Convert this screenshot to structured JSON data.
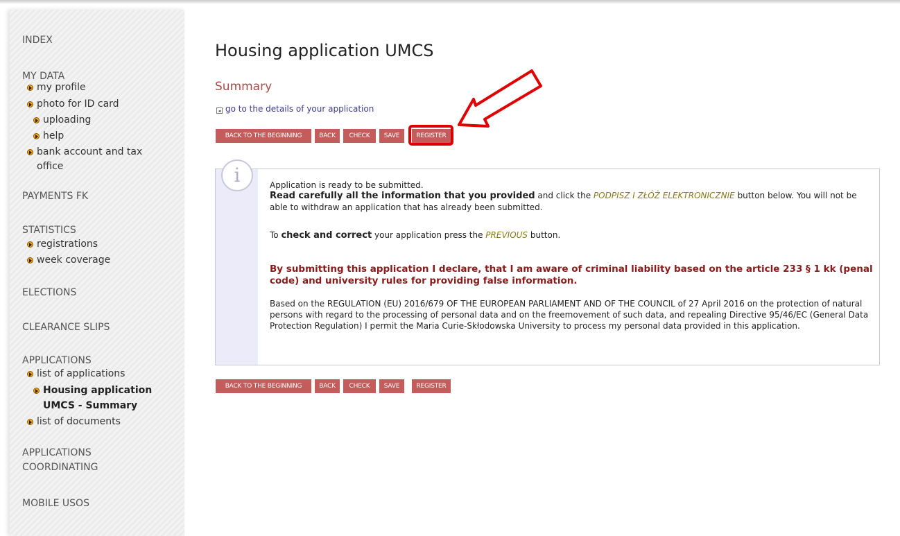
{
  "sidebar": {
    "index": "INDEX",
    "my_data": "MY DATA",
    "my_profile": "my profile",
    "photo": "photo for ID card",
    "uploading": "uploading",
    "help": "help",
    "bank_line1": "bank account and tax",
    "bank_line2": "office",
    "payments": "PAYMENTS FK",
    "statistics": "STATISTICS",
    "registrations": "registrations",
    "week_coverage": "week coverage",
    "elections": "ELECTIONS",
    "clearance": "CLEARANCE SLIPS",
    "applications": "APPLICATIONS",
    "list_applications": "list of applications",
    "current_line1": "Housing application",
    "current_line2": "UMCS - Summary",
    "list_documents": "list of documents",
    "coord_line1": "APPLICATIONS",
    "coord_line2": "COORDINATING",
    "mobile": "MOBILE USOS"
  },
  "main": {
    "title": "Housing application UMCS",
    "subtitle": "Summary",
    "details_link": "go to the details of your application"
  },
  "buttons": {
    "back_to_beginning": "BACK TO THE BEGINNING",
    "back": "BACK",
    "check": "CHECK",
    "save": "SAVE",
    "register": "REGISTER"
  },
  "info": {
    "line1": "Application is ready to be submitted.",
    "read_bold": "Read carefully all the information that you provided",
    "read_after1": " and click the ",
    "sign_button": "PODPISZ I ZŁÓŻ ELEKTRONICZNIE",
    "read_after2": " button below. You will not be able to withdraw an application that has already been submitted.",
    "to": "To ",
    "check_bold": "check and correct",
    "check_after1": " your application press the ",
    "previous": "PREVIOUS",
    "check_after2": " button.",
    "declaration": "By submitting this application I declare, that I am aware of criminal liability based on the article 233 § 1 kk (penal code) and university rules for providing false information.",
    "gdpr": "Based on the REGULATION (EU) 2016/679 OF THE EUROPEAN PARLIAMENT AND OF THE COUNCIL of 27 April 2016 on the protection of natural persons with regard to the processing of personal data and on the freemovement of such data, and repealing Directive 95/46/EC (General Data Protection Regulation) I permit the Maria Curie-Skłodowska University to process my personal data provided in this application.",
    "icon_glyph": "i"
  },
  "colors": {
    "button_bg": "#c45c5c",
    "highlight": "#d80000",
    "summary_text": "#a94b4b",
    "warning_text": "#8b1a1a"
  },
  "icons": {
    "bullet": "orange-bullet-arrow-icon",
    "details": "expand-box-icon",
    "info": "info-circle-icon",
    "annotation": "red-arrow-annotation"
  }
}
